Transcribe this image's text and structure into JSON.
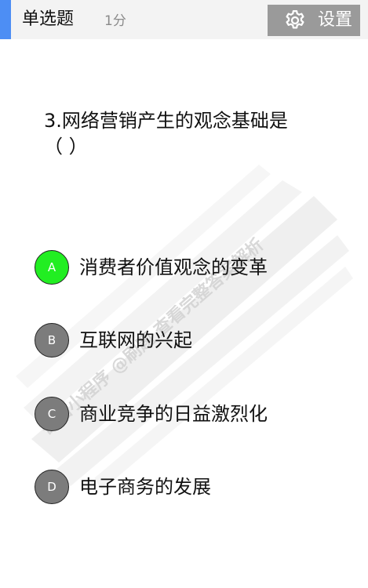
{
  "header": {
    "title": "单选题",
    "score": "1分",
    "settings_label": "设置",
    "accent_color": "#4d8ef4"
  },
  "question": {
    "line1": "3.网络营销产生的观念基础是",
    "line2": "（      ）"
  },
  "options": [
    {
      "letter": "A",
      "text": "消费者价值观念的变革",
      "selected": true,
      "color": "#22ee22"
    },
    {
      "letter": "B",
      "text": "互联网的兴起",
      "selected": false,
      "color": "#7c7c7c"
    },
    {
      "letter": "C",
      "text": "商业竞争的日益激烈化",
      "selected": false,
      "color": "#7c7c7c"
    },
    {
      "letter": "D",
      "text": "电子商务的发展",
      "selected": false,
      "color": "#7c7c7c"
    }
  ],
  "watermark": {
    "line1": "微信小程序 @刷题 查看完整答案解析"
  },
  "icons": {
    "settings": "gear-icon"
  }
}
